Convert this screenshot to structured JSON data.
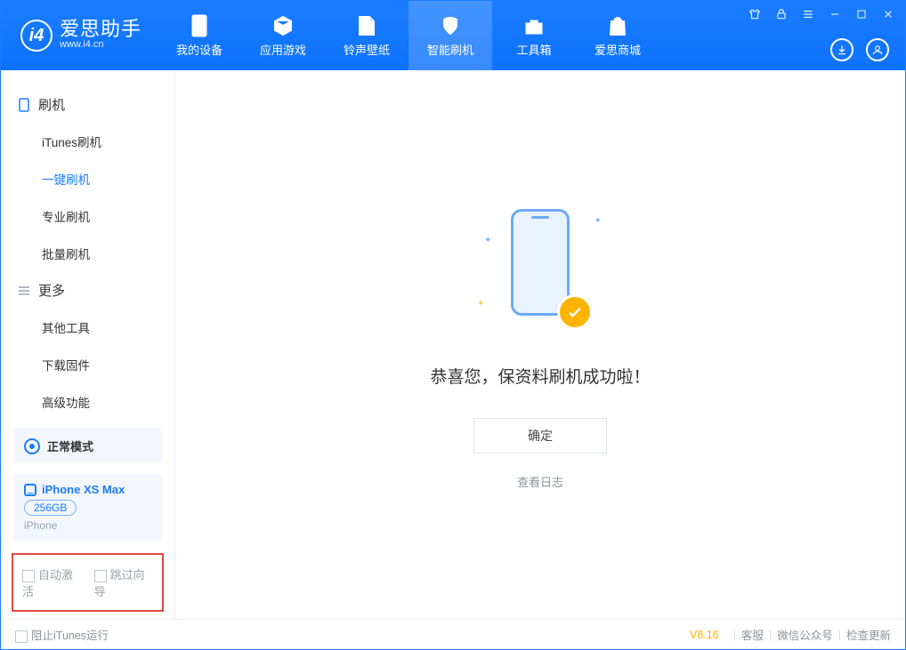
{
  "app": {
    "title": "爱思助手",
    "subtitle": "www.i4.cn"
  },
  "nav": [
    {
      "label": "我的设备"
    },
    {
      "label": "应用游戏"
    },
    {
      "label": "铃声壁纸"
    },
    {
      "label": "智能刷机"
    },
    {
      "label": "工具箱"
    },
    {
      "label": "爱思商城"
    }
  ],
  "sidebar": {
    "sections": [
      {
        "title": "刷机",
        "items": [
          "iTunes刷机",
          "一键刷机",
          "专业刷机",
          "批量刷机"
        ]
      },
      {
        "title": "更多",
        "items": [
          "其他工具",
          "下载固件",
          "高级功能"
        ]
      }
    ],
    "activeItem": "一键刷机",
    "mode": "正常模式",
    "device": {
      "name": "iPhone XS Max",
      "capacity": "256GB",
      "type": "iPhone"
    },
    "checks": {
      "autoActivate": "自动激活",
      "skipGuide": "跳过向导"
    }
  },
  "main": {
    "successText": "恭喜您，保资料刷机成功啦！",
    "okLabel": "确定",
    "logLink": "查看日志"
  },
  "status": {
    "blockItunes": "阻止iTunes运行",
    "version": "V8.16",
    "links": [
      "客服",
      "微信公众号",
      "检查更新"
    ]
  }
}
